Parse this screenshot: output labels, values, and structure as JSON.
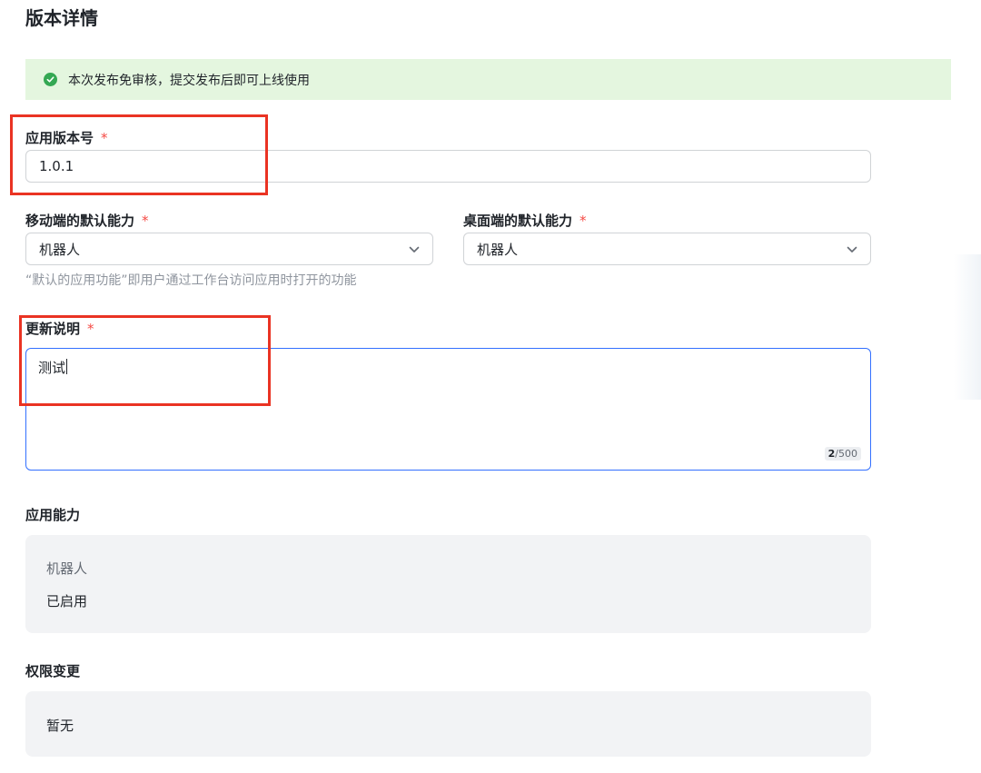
{
  "page": {
    "title": "版本详情"
  },
  "notice": {
    "text": "本次发布免审核，提交发布后即可上线使用"
  },
  "version": {
    "label": "应用版本号",
    "required_mark": "*",
    "value": "1.0.1"
  },
  "mobile_default": {
    "label": "移动端的默认能力",
    "required_mark": "*",
    "value": "机器人"
  },
  "desktop_default": {
    "label": "桌面端的默认能力",
    "required_mark": "*",
    "value": "机器人"
  },
  "default_hint": "“默认的应用功能”即用户通过工作台访问应用时打开的功能",
  "release_notes": {
    "label": "更新说明",
    "required_mark": "*",
    "value": "测试",
    "count": "2",
    "max": "/500"
  },
  "app_capability": {
    "label": "应用能力",
    "name": "机器人",
    "status": "已启用"
  },
  "permission_changes": {
    "label": "权限变更",
    "value": "暂无"
  },
  "colors": {
    "accent": "#3370ff",
    "success": "#34a853",
    "required": "#f54a45",
    "annotation": "#ea3323"
  }
}
